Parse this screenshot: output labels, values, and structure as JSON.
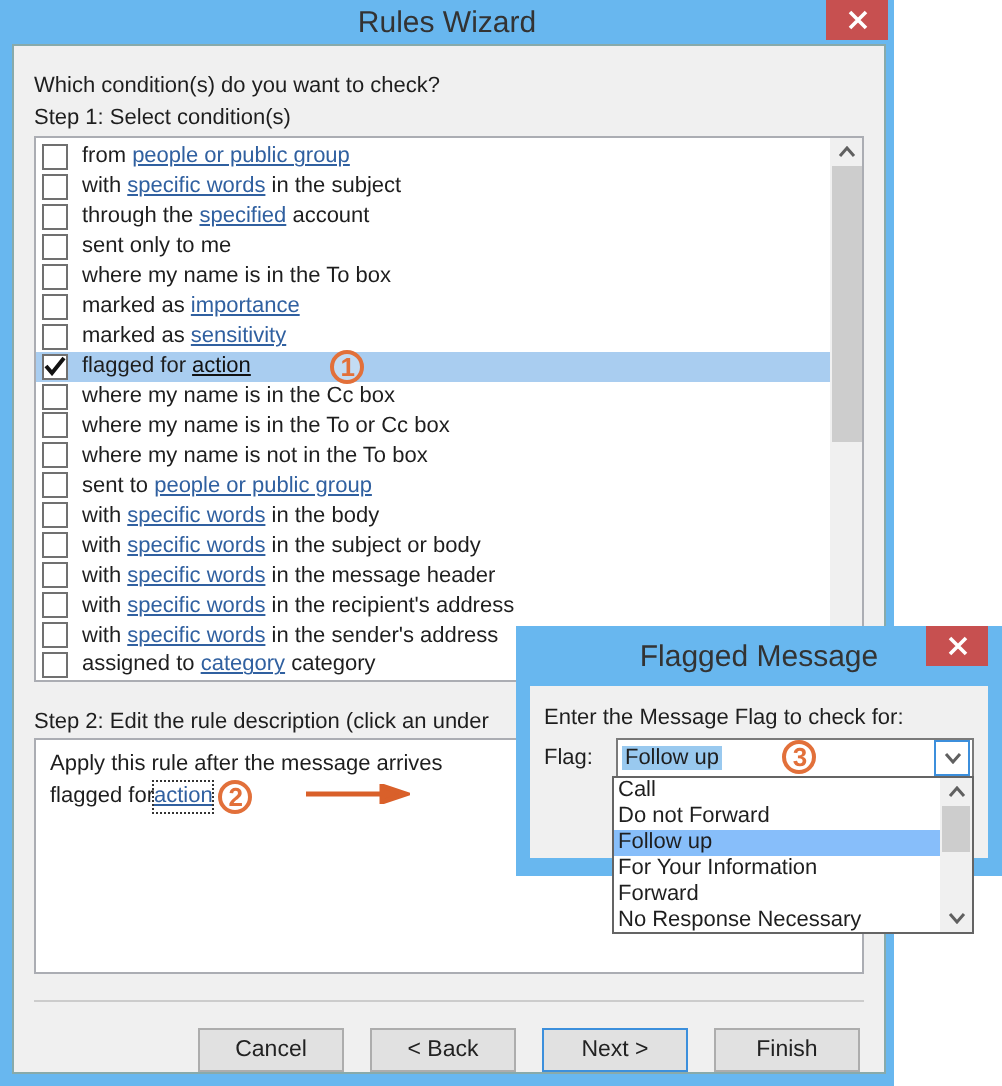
{
  "window": {
    "title": "Rules Wizard"
  },
  "question": "Which condition(s) do you want to check?",
  "step1": "Step 1: Select condition(s)",
  "conditions": [
    {
      "before": "from ",
      "link": "people or public group",
      "checked": false,
      "selected": false
    },
    {
      "before": "with ",
      "link": "specific words",
      "after": " in the subject",
      "checked": false,
      "selected": false
    },
    {
      "before": "through the ",
      "link": "specified",
      "after": " account",
      "checked": false,
      "selected": false
    },
    {
      "before": "sent only to me",
      "checked": false,
      "selected": false
    },
    {
      "before": "where my name is in the To box",
      "checked": false,
      "selected": false
    },
    {
      "before": "marked as ",
      "link": "importance",
      "checked": false,
      "selected": false
    },
    {
      "before": "marked as ",
      "link": "sensitivity",
      "checked": false,
      "selected": false
    },
    {
      "before": "flagged for ",
      "link": "action",
      "checked": true,
      "selected": true,
      "callout": "1"
    },
    {
      "before": "where my name is in the Cc box",
      "checked": false,
      "selected": false
    },
    {
      "before": "where my name is in the To or Cc box",
      "checked": false,
      "selected": false
    },
    {
      "before": "where my name is not in the To box",
      "checked": false,
      "selected": false
    },
    {
      "before": "sent to ",
      "link": "people or public group",
      "checked": false,
      "selected": false
    },
    {
      "before": "with ",
      "link": "specific words",
      "after": " in the body",
      "checked": false,
      "selected": false
    },
    {
      "before": "with ",
      "link": "specific words",
      "after": " in the subject or body",
      "checked": false,
      "selected": false
    },
    {
      "before": "with ",
      "link": "specific words",
      "after": " in the message header",
      "checked": false,
      "selected": false
    },
    {
      "before": "with ",
      "link": "specific words",
      "after": " in the recipient's address",
      "checked": false,
      "selected": false
    },
    {
      "before": "with ",
      "link": "specific words",
      "after": " in the sender's address",
      "checked": false,
      "selected": false
    },
    {
      "before": "assigned to ",
      "link": "category",
      "after": " category",
      "checked": false,
      "selected": false
    }
  ],
  "step2": "Step 2: Edit the rule description (click an under",
  "description": {
    "line1": "Apply this rule after the message arrives",
    "line2_before": "flagged for ",
    "line2_link": "action",
    "callout": "2"
  },
  "buttons": [
    {
      "label": "Cancel",
      "default": false
    },
    {
      "label": "< Back",
      "default": false
    },
    {
      "label": "Next >",
      "default": true
    },
    {
      "label": "Finish",
      "default": false
    }
  ],
  "flag_dialog": {
    "title": "Flagged Message",
    "prompt": "Enter the Message Flag to check for:",
    "flag_label": "Flag:",
    "value": "Follow up",
    "callout": "3",
    "options": [
      {
        "label": "Call",
        "selected": false
      },
      {
        "label": "Do not Forward",
        "selected": false
      },
      {
        "label": "Follow up",
        "selected": true
      },
      {
        "label": "For Your Information",
        "selected": false
      },
      {
        "label": "Forward",
        "selected": false
      },
      {
        "label": "No Response Necessary",
        "selected": false
      }
    ]
  }
}
